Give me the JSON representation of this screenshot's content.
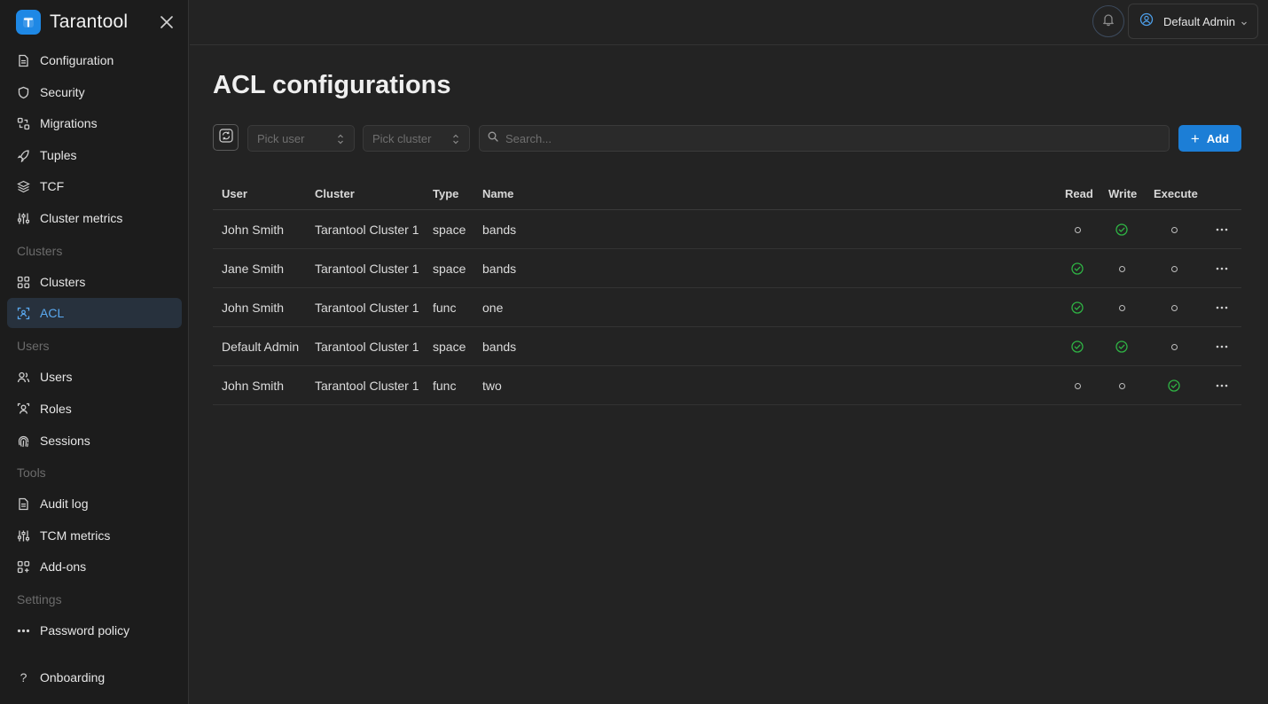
{
  "app": {
    "name": "Tarantool"
  },
  "sidebar": {
    "items": [
      {
        "label": "Configuration",
        "icon": "file-icon"
      },
      {
        "label": "Security",
        "icon": "shield-icon"
      },
      {
        "label": "Migrations",
        "icon": "migrations-icon"
      },
      {
        "label": "Tuples",
        "icon": "rocket-icon"
      },
      {
        "label": "TCF",
        "icon": "stack-icon"
      },
      {
        "label": "Cluster metrics",
        "icon": "sliders-icon"
      }
    ],
    "section_clusters": "Clusters",
    "cluster_items": [
      {
        "label": "Clusters",
        "icon": "grid-icon"
      },
      {
        "label": "ACL",
        "icon": "acl-icon",
        "active": true
      }
    ],
    "section_users": "Users",
    "user_items": [
      {
        "label": "Users",
        "icon": "users-icon"
      },
      {
        "label": "Roles",
        "icon": "roles-icon"
      },
      {
        "label": "Sessions",
        "icon": "fingerprint-icon"
      }
    ],
    "section_tools": "Tools",
    "tool_items": [
      {
        "label": "Audit log",
        "icon": "file-icon"
      },
      {
        "label": "TCM metrics",
        "icon": "sliders-icon"
      },
      {
        "label": "Add-ons",
        "icon": "add-ons-icon"
      }
    ],
    "section_settings": "Settings",
    "settings_items": [
      {
        "label": "Password policy",
        "icon": "dots-icon"
      }
    ],
    "onboarding": {
      "label": "Onboarding",
      "icon": "question-icon"
    }
  },
  "header": {
    "user_name": "Default Admin"
  },
  "page": {
    "title": "ACL configurations",
    "pick_user_placeholder": "Pick user",
    "pick_cluster_placeholder": "Pick cluster",
    "search_placeholder": "Search...",
    "add_label": "Add"
  },
  "colors": {
    "accent": "#1c7ed6",
    "granted": "#2fb344",
    "active_nav": "#5aa9f0"
  },
  "table": {
    "columns": [
      "User",
      "Cluster",
      "Type",
      "Name",
      "Read",
      "Write",
      "Execute"
    ],
    "rows": [
      {
        "user": "John Smith",
        "cluster": "Tarantool Cluster 1",
        "type": "space",
        "name": "bands",
        "read": false,
        "write": true,
        "execute": false
      },
      {
        "user": "Jane Smith",
        "cluster": "Tarantool Cluster 1",
        "type": "space",
        "name": "bands",
        "read": true,
        "write": false,
        "execute": false
      },
      {
        "user": "John Smith",
        "cluster": "Tarantool Cluster 1",
        "type": "func",
        "name": "one",
        "read": true,
        "write": false,
        "execute": false
      },
      {
        "user": "Default Admin",
        "cluster": "Tarantool Cluster 1",
        "type": "space",
        "name": "bands",
        "read": true,
        "write": true,
        "execute": false
      },
      {
        "user": "John Smith",
        "cluster": "Tarantool Cluster 1",
        "type": "func",
        "name": "two",
        "read": false,
        "write": false,
        "execute": true
      }
    ]
  }
}
